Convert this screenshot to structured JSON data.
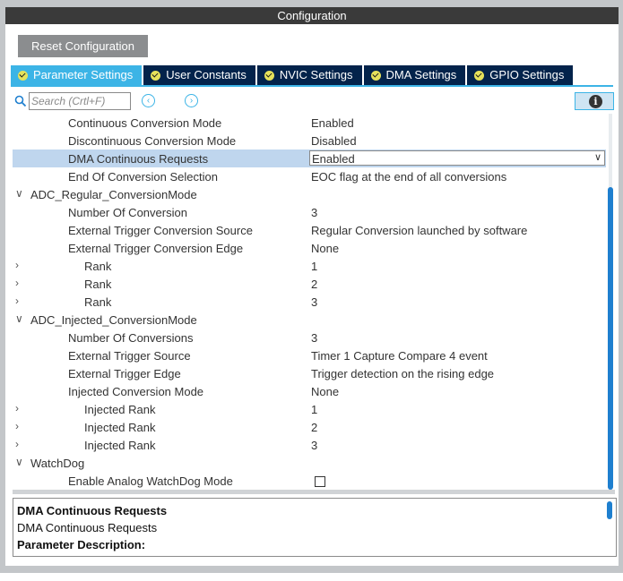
{
  "window": {
    "title": "Configuration"
  },
  "toolbar": {
    "reset_label": "Reset Configuration"
  },
  "tabs": [
    {
      "label": "Parameter Settings",
      "active": true
    },
    {
      "label": "User Constants",
      "active": false
    },
    {
      "label": "NVIC Settings",
      "active": false
    },
    {
      "label": "DMA Settings",
      "active": false
    },
    {
      "label": "GPIO Settings",
      "active": false
    }
  ],
  "search": {
    "placeholder": "Search (Crtl+F)",
    "prev_icon": "chevron-left-circle-icon",
    "next_icon": "chevron-right-circle-icon",
    "info_icon": "info-icon"
  },
  "params": {
    "r0": {
      "label": "Continuous Conversion Mode",
      "value": "Enabled"
    },
    "r1": {
      "label": "Discontinuous Conversion Mode",
      "value": "Disabled"
    },
    "r2": {
      "label": "DMA Continuous Requests",
      "value": "Enabled"
    },
    "r3": {
      "label": "End Of Conversion Selection",
      "value": "EOC flag at the end of all conversions"
    },
    "g1": {
      "label": "ADC_Regular_ConversionMode"
    },
    "r4": {
      "label": "Number Of Conversion",
      "value": "3"
    },
    "r5": {
      "label": "External Trigger Conversion Source",
      "value": "Regular Conversion launched by software"
    },
    "r6": {
      "label": "External Trigger Conversion Edge",
      "value": "None"
    },
    "r7": {
      "label": "Rank",
      "value": "1"
    },
    "r8": {
      "label": "Rank",
      "value": "2"
    },
    "r9": {
      "label": "Rank",
      "value": "3"
    },
    "g2": {
      "label": "ADC_Injected_ConversionMode"
    },
    "r10": {
      "label": "Number Of Conversions",
      "value": "3"
    },
    "r11": {
      "label": "External Trigger Source",
      "value": "Timer 1 Capture Compare 4 event"
    },
    "r12": {
      "label": "External Trigger Edge",
      "value": "Trigger detection on the rising edge"
    },
    "r13": {
      "label": "Injected Conversion Mode",
      "value": "None"
    },
    "r14": {
      "label": "Injected Rank",
      "value": "1"
    },
    "r15": {
      "label": "Injected Rank",
      "value": "2"
    },
    "r16": {
      "label": "Injected Rank",
      "value": "3"
    },
    "g3": {
      "label": "WatchDog"
    },
    "r17": {
      "label": "Enable Analog WatchDog Mode",
      "checked": false
    }
  },
  "description": {
    "title": "DMA Continuous Requests",
    "name": "DMA Continuous Requests",
    "heading": "Parameter Description:"
  },
  "colors": {
    "accent": "#3cb4e6",
    "tab_bg": "#03234b",
    "selected_row": "#bfd6ee",
    "check": "#e6e25b"
  }
}
